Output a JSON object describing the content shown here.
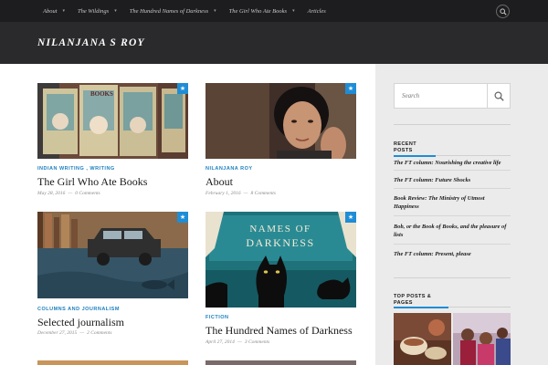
{
  "nav": {
    "items": [
      {
        "label": "About",
        "dropdown": true
      },
      {
        "label": "The Wildings",
        "dropdown": true
      },
      {
        "label": "The Hundred Names of Darkness",
        "dropdown": true
      },
      {
        "label": "The Girl Who Ate Books",
        "dropdown": true
      },
      {
        "label": "Articles",
        "dropdown": false
      }
    ]
  },
  "site": {
    "title": "NILANJANA S ROY"
  },
  "posts": [
    {
      "category": "INDIAN WRITING , WRITING",
      "title": "The Girl Who Ate Books",
      "date": "May 28, 2016",
      "comments": "0 Comments",
      "sticky": true
    },
    {
      "category": "NILANJANA ROY",
      "title": "About",
      "date": "February 1, 2016",
      "comments": "8 Comments",
      "sticky": true
    },
    {
      "category": "COLUMNS AND JOURNALISM",
      "title": "Selected journalism",
      "date": "December 27, 2015",
      "comments": "2 Comments",
      "sticky": true
    },
    {
      "category": "FICTION",
      "title": "The Hundred Names of Darkness",
      "date": "April 27, 2014",
      "comments": "3 Comments",
      "sticky": true
    }
  ],
  "book_cover_text": {
    "line1": "NAMES OF",
    "line2": "DARKNESS"
  },
  "sidebar": {
    "search_placeholder": "Search",
    "recent_heading": "RECENT POSTS",
    "recent_posts": [
      "The FT column: Nourishing the creative life",
      "The FT column: Future Shocks",
      "Book Review: The Ministry of Utmost Happiness",
      "Bob, or the Book of Books, and the pleasure of lists",
      "The FT column: Present, please"
    ],
    "top_heading": "TOP POSTS & PAGES"
  },
  "icons": {
    "search": "search-icon",
    "sticky": "star-icon",
    "dropdown": "chevron-down-icon"
  },
  "colors": {
    "accent": "#1f8dd6",
    "nav_bg": "#1d1d1f",
    "header_bg": "#2a2a2c"
  }
}
